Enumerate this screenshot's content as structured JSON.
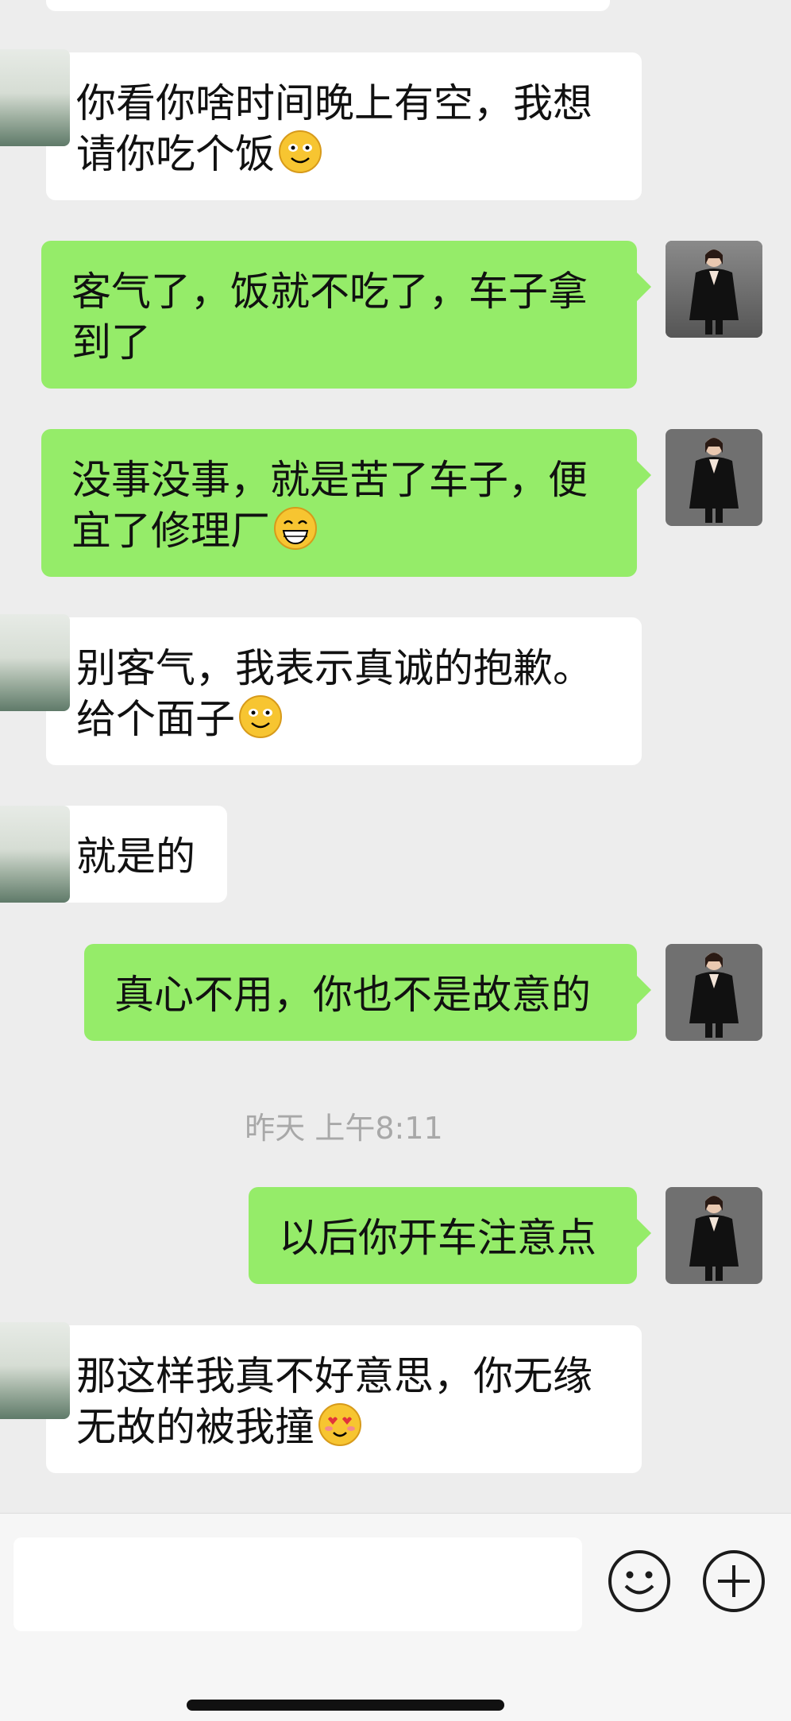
{
  "conversation": {
    "messages": [
      {
        "side": "in",
        "text": "你看你啥时间晚上有空，我想请你吃个饭",
        "emoji": "smile-emoji"
      },
      {
        "side": "out",
        "text": "客气了，饭就不吃了，车子拿到了"
      },
      {
        "side": "out",
        "text": "没事没事，就是苦了车子，便宜了修理厂",
        "emoji": "grin-emoji"
      },
      {
        "side": "in",
        "text": "别客气，我表示真诚的抱歉。给个面子",
        "emoji": "smile-emoji"
      },
      {
        "side": "in",
        "text": "就是的"
      },
      {
        "side": "out",
        "text": "真心不用，你也不是故意的"
      },
      {
        "side": "out",
        "text": "以后你开车注意点"
      },
      {
        "side": "in",
        "text": "那这样我真不好意思，你无缘无故的被我撞",
        "emoji": "heart-eyes-emoji"
      }
    ],
    "timestamp": "昨天 上午8:11"
  },
  "input_bar": {
    "placeholder": "",
    "emoji_icon": "emoji-face-icon",
    "plus_icon": "plus-circle-icon"
  },
  "colors": {
    "background": "#ededed",
    "incoming_bubble": "#ffffff",
    "outgoing_bubble": "#95ec69",
    "timestamp_text": "#a8a8a8"
  }
}
